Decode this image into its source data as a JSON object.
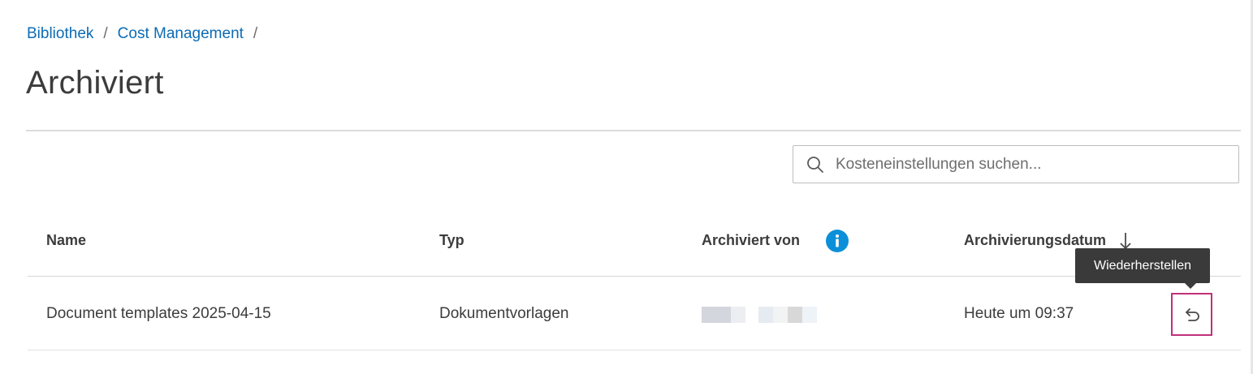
{
  "breadcrumb": {
    "items": [
      "Bibliothek",
      "Cost Management"
    ],
    "separator": "/"
  },
  "page": {
    "title": "Archiviert"
  },
  "search": {
    "placeholder": "Kosteneinstellungen suchen...",
    "value": ""
  },
  "table": {
    "columns": {
      "name": "Name",
      "type": "Typ",
      "archived_by": "Archiviert von",
      "archived_date": "Archivierungsdatum"
    },
    "sort": {
      "column": "archived_date",
      "direction": "descending"
    },
    "rows": [
      {
        "name": "Document templates 2025-04-15",
        "type": "Dokumentvorlagen",
        "archived_by": "",
        "archived_date": "Heute um 09:37"
      }
    ]
  },
  "tooltip": {
    "text": "Wiederherstellen"
  },
  "icons": {
    "search": "search-icon",
    "info": "info-icon",
    "sort": "sort-descending-icon",
    "restore": "undo-arrow-icon"
  },
  "colors": {
    "link": "#0c6bb5",
    "info": "#0c8fd9",
    "focus_outline": "#c1307a",
    "tooltip_bg": "#3a3a3a"
  }
}
